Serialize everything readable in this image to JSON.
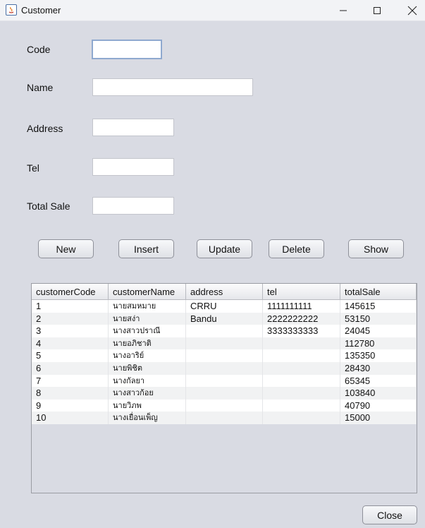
{
  "window": {
    "title": "Customer",
    "controls": {
      "minimize": "minimize-icon",
      "maximize": "maximize-icon",
      "close": "close-icon"
    }
  },
  "form": {
    "code_label": "Code",
    "code_value": "",
    "name_label": "Name",
    "name_value": "",
    "address_label": "Address",
    "address_value": "",
    "tel_label": "Tel",
    "tel_value": "",
    "total_sale_label": "Total Sale",
    "total_sale_value": ""
  },
  "buttons": {
    "new": "New",
    "insert": "Insert",
    "update": "Update",
    "delete": "Delete",
    "show": "Show",
    "close": "Close"
  },
  "table": {
    "columns": [
      "customerCode",
      "customerName",
      "address",
      "tel",
      "totalSale"
    ],
    "rows": [
      [
        "1",
        "นายสมหมาย",
        "CRRU",
        "1111111111",
        "145615"
      ],
      [
        "2",
        "นายสง่า",
        "Bandu",
        "2222222222",
        "53150"
      ],
      [
        "3",
        "นางสาวปราณี",
        "",
        "3333333333",
        "24045"
      ],
      [
        "4",
        "นายอภิชาติ",
        "",
        "",
        "112780"
      ],
      [
        "5",
        "นางอาริย์",
        "",
        "",
        "135350"
      ],
      [
        "6",
        "นายพิชิต",
        "",
        "",
        "28430"
      ],
      [
        "7",
        "นางกัลยา",
        "",
        "",
        "65345"
      ],
      [
        "8",
        "นางสาวก้อย",
        "",
        "",
        "103840"
      ],
      [
        "9",
        "นายวิภพ",
        "",
        "",
        "40790"
      ],
      [
        "10",
        "นางเยื่อนเพ็ญ",
        "",
        "",
        "15000"
      ]
    ]
  }
}
